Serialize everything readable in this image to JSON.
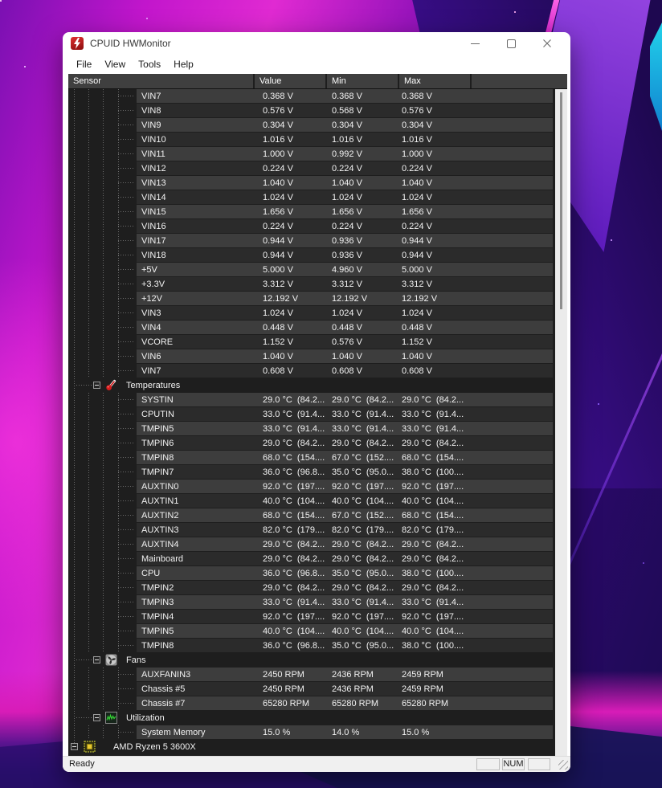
{
  "theme": {
    "accent-red": "#c61a24",
    "header-bg": "#3f3f3f",
    "table-bg": "#1e1e1e",
    "row-light": "#3d3d3d",
    "row-dark": "#2b2b2b",
    "row-text": "#f2f2f2",
    "chrome-bg": "#ffffff",
    "status-bg": "#f0f0f0"
  },
  "window": {
    "title": "CPUID HWMonitor",
    "app_icon": "hwmonitor-lightning-icon",
    "menu": [
      "File",
      "View",
      "Tools",
      "Help"
    ],
    "columns": [
      "Sensor",
      "Value",
      "Min",
      "Max"
    ],
    "status": {
      "ready": "Ready",
      "num": "NUM"
    }
  },
  "table": {
    "rows": [
      {
        "type": "leaf",
        "label": "VIN7",
        "value": "0.368 V",
        "min": "0.368 V",
        "max": "0.368 V"
      },
      {
        "type": "leaf",
        "label": "VIN8",
        "value": "0.576 V",
        "min": "0.568 V",
        "max": "0.576 V"
      },
      {
        "type": "leaf",
        "label": "VIN9",
        "value": "0.304 V",
        "min": "0.304 V",
        "max": "0.304 V"
      },
      {
        "type": "leaf",
        "label": "VIN10",
        "value": "1.016 V",
        "min": "1.016 V",
        "max": "1.016 V"
      },
      {
        "type": "leaf",
        "label": "VIN11",
        "value": "1.000 V",
        "min": "0.992 V",
        "max": "1.000 V"
      },
      {
        "type": "leaf",
        "label": "VIN12",
        "value": "0.224 V",
        "min": "0.224 V",
        "max": "0.224 V"
      },
      {
        "type": "leaf",
        "label": "VIN13",
        "value": "1.040 V",
        "min": "1.040 V",
        "max": "1.040 V"
      },
      {
        "type": "leaf",
        "label": "VIN14",
        "value": "1.024 V",
        "min": "1.024 V",
        "max": "1.024 V"
      },
      {
        "type": "leaf",
        "label": "VIN15",
        "value": "1.656 V",
        "min": "1.656 V",
        "max": "1.656 V"
      },
      {
        "type": "leaf",
        "label": "VIN16",
        "value": "0.224 V",
        "min": "0.224 V",
        "max": "0.224 V"
      },
      {
        "type": "leaf",
        "label": "VIN17",
        "value": "0.944 V",
        "min": "0.936 V",
        "max": "0.944 V"
      },
      {
        "type": "leaf",
        "label": "VIN18",
        "value": "0.944 V",
        "min": "0.936 V",
        "max": "0.944 V"
      },
      {
        "type": "leaf",
        "label": "+5V",
        "value": "5.000 V",
        "min": "4.960 V",
        "max": "5.000 V"
      },
      {
        "type": "leaf",
        "label": "+3.3V",
        "value": "3.312 V",
        "min": "3.312 V",
        "max": "3.312 V"
      },
      {
        "type": "leaf",
        "label": "+12V",
        "value": "12.192 V",
        "min": "12.192 V",
        "max": "12.192 V"
      },
      {
        "type": "leaf",
        "label": "VIN3",
        "value": "1.024 V",
        "min": "1.024 V",
        "max": "1.024 V"
      },
      {
        "type": "leaf",
        "label": "VIN4",
        "value": "0.448 V",
        "min": "0.448 V",
        "max": "0.448 V"
      },
      {
        "type": "leaf",
        "label": "VCORE",
        "value": "1.152 V",
        "min": "0.576 V",
        "max": "1.152 V"
      },
      {
        "type": "leaf",
        "label": "VIN6",
        "value": "1.040 V",
        "min": "1.040 V",
        "max": "1.040 V"
      },
      {
        "type": "leaf",
        "label": "VIN7",
        "value": "0.608 V",
        "min": "0.608 V",
        "max": "0.608 V"
      },
      {
        "type": "section",
        "label": "Temperatures",
        "icon": "thermometer-icon",
        "level": 1
      },
      {
        "type": "leaf",
        "label": "SYSTIN",
        "value": "29.0 °C  (84.2...",
        "min": "29.0 °C  (84.2...",
        "max": "29.0 °C  (84.2..."
      },
      {
        "type": "leaf",
        "label": "CPUTIN",
        "value": "33.0 °C  (91.4...",
        "min": "33.0 °C  (91.4...",
        "max": "33.0 °C  (91.4..."
      },
      {
        "type": "leaf",
        "label": "TMPIN5",
        "value": "33.0 °C  (91.4...",
        "min": "33.0 °C  (91.4...",
        "max": "33.0 °C  (91.4..."
      },
      {
        "type": "leaf",
        "label": "TMPIN6",
        "value": "29.0 °C  (84.2...",
        "min": "29.0 °C  (84.2...",
        "max": "29.0 °C  (84.2..."
      },
      {
        "type": "leaf",
        "label": "TMPIN8",
        "value": "68.0 °C  (154....",
        "min": "67.0 °C  (152....",
        "max": "68.0 °C  (154...."
      },
      {
        "type": "leaf",
        "label": "TMPIN7",
        "value": "36.0 °C  (96.8...",
        "min": "35.0 °C  (95.0...",
        "max": "38.0 °C  (100...."
      },
      {
        "type": "leaf",
        "label": "AUXTIN0",
        "value": "92.0 °C  (197....",
        "min": "92.0 °C  (197....",
        "max": "92.0 °C  (197...."
      },
      {
        "type": "leaf",
        "label": "AUXTIN1",
        "value": "40.0 °C  (104....",
        "min": "40.0 °C  (104....",
        "max": "40.0 °C  (104...."
      },
      {
        "type": "leaf",
        "label": "AUXTIN2",
        "value": "68.0 °C  (154....",
        "min": "67.0 °C  (152....",
        "max": "68.0 °C  (154...."
      },
      {
        "type": "leaf",
        "label": "AUXTIN3",
        "value": "82.0 °C  (179....",
        "min": "82.0 °C  (179....",
        "max": "82.0 °C  (179...."
      },
      {
        "type": "leaf",
        "label": "AUXTIN4",
        "value": "29.0 °C  (84.2...",
        "min": "29.0 °C  (84.2...",
        "max": "29.0 °C  (84.2..."
      },
      {
        "type": "leaf",
        "label": "Mainboard",
        "value": "29.0 °C  (84.2...",
        "min": "29.0 °C  (84.2...",
        "max": "29.0 °C  (84.2..."
      },
      {
        "type": "leaf",
        "label": "CPU",
        "value": "36.0 °C  (96.8...",
        "min": "35.0 °C  (95.0...",
        "max": "38.0 °C  (100...."
      },
      {
        "type": "leaf",
        "label": "TMPIN2",
        "value": "29.0 °C  (84.2...",
        "min": "29.0 °C  (84.2...",
        "max": "29.0 °C  (84.2..."
      },
      {
        "type": "leaf",
        "label": "TMPIN3",
        "value": "33.0 °C  (91.4...",
        "min": "33.0 °C  (91.4...",
        "max": "33.0 °C  (91.4..."
      },
      {
        "type": "leaf",
        "label": "TMPIN4",
        "value": "92.0 °C  (197....",
        "min": "92.0 °C  (197....",
        "max": "92.0 °C  (197...."
      },
      {
        "type": "leaf",
        "label": "TMPIN5",
        "value": "40.0 °C  (104....",
        "min": "40.0 °C  (104....",
        "max": "40.0 °C  (104...."
      },
      {
        "type": "leaf",
        "label": "TMPIN8",
        "value": "36.0 °C  (96.8...",
        "min": "35.0 °C  (95.0...",
        "max": "38.0 °C  (100...."
      },
      {
        "type": "section",
        "label": "Fans",
        "icon": "fan-icon",
        "level": 1
      },
      {
        "type": "leaf",
        "label": "AUXFANIN3",
        "value": "2450 RPM",
        "min": "2436 RPM",
        "max": "2459 RPM"
      },
      {
        "type": "leaf",
        "label": "Chassis #5",
        "value": "2450 RPM",
        "min": "2436 RPM",
        "max": "2459 RPM"
      },
      {
        "type": "leaf",
        "label": "Chassis #7",
        "value": "65280 RPM",
        "min": "65280 RPM",
        "max": "65280 RPM"
      },
      {
        "type": "section",
        "label": "Utilization",
        "icon": "utilization-icon",
        "level": 1
      },
      {
        "type": "leaf",
        "label": "System Memory",
        "value": "15.0 %",
        "min": "14.0 %",
        "max": "15.0 %"
      },
      {
        "type": "section",
        "label": "AMD Ryzen 5 3600X",
        "icon": "cpu-icon",
        "level": 0
      }
    ]
  }
}
